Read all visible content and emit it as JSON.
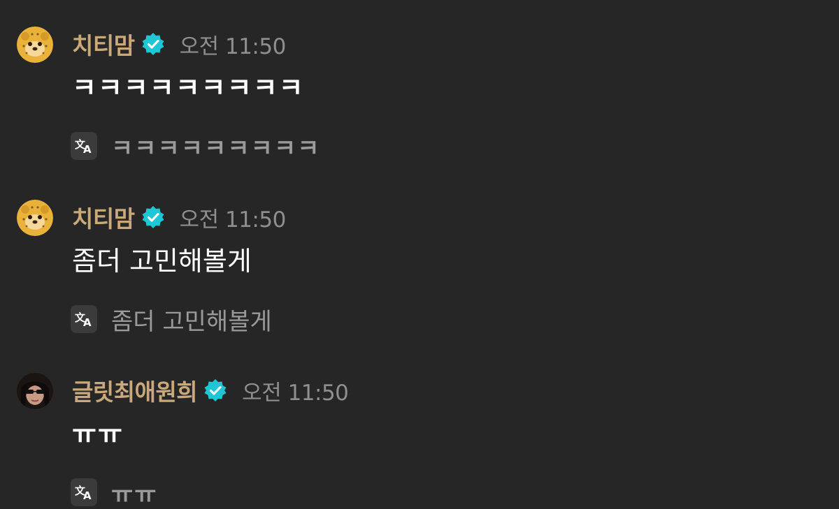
{
  "messages": [
    {
      "avatar_icon": "cheetah-avatar-icon",
      "username": "치티맘",
      "verified_icon": "verified-badge-icon",
      "timestamp": "오전 11:50",
      "text": "ㅋㅋㅋㅋㅋㅋㅋㅋㅋ",
      "translate_icon": "translate-icon",
      "translation": "ㅋㅋㅋㅋㅋㅋㅋㅋㅋ"
    },
    {
      "avatar_icon": "cheetah-avatar-icon",
      "username": "치티맘",
      "verified_icon": "verified-badge-icon",
      "timestamp": "오전 11:50",
      "text": "좀더 고민해볼게",
      "translate_icon": "translate-icon",
      "translation": "좀더 고민해볼게"
    },
    {
      "avatar_icon": "user-photo-avatar-icon",
      "username": "글릿최애원희",
      "verified_icon": "verified-badge-icon",
      "timestamp": "오전 11:50",
      "text": "ㅠㅠ",
      "translate_icon": "translate-icon",
      "translation": "ㅠㅠ"
    }
  ],
  "colors": {
    "background": "#262626",
    "username": "#c9a97a",
    "timestamp": "#8f8f8f",
    "message_text": "#ffffff",
    "translation_text": "#9a9a9a",
    "verified_badge": "#1fc7d4"
  }
}
